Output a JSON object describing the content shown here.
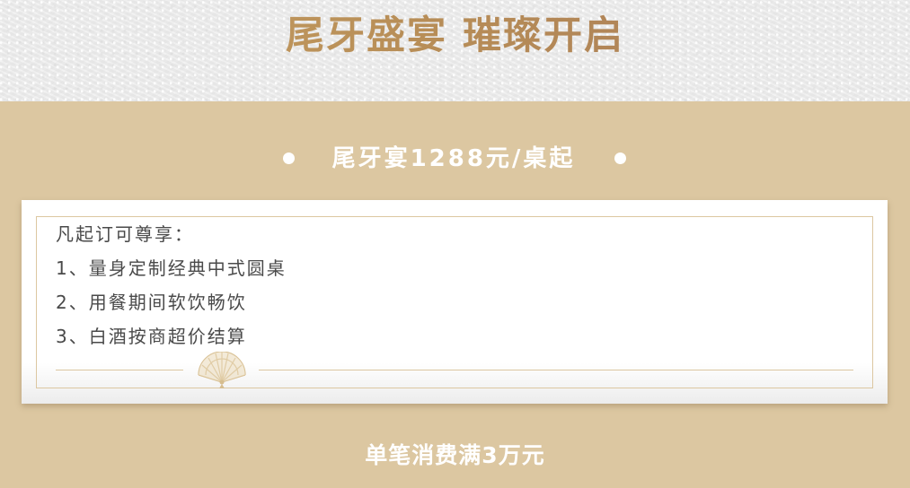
{
  "header": {
    "title": "尾牙盛宴  璀璨开启"
  },
  "price_banner": {
    "text": "尾牙宴1288元/桌起"
  },
  "perks": {
    "title": "凡起订可尊享：",
    "items": [
      "1、量身定制经典中式圆桌",
      "2、用餐期间软饮畅饮",
      "3、白酒按商超价结算"
    ]
  },
  "footer": {
    "threshold": "单笔消费满3万元"
  },
  "colors": {
    "background": "#dcc7a1",
    "title_gold": "#c9a266",
    "text_dark": "#4a4a4a",
    "white": "#ffffff"
  },
  "icons": {
    "decor": "folding-fan-icon"
  }
}
